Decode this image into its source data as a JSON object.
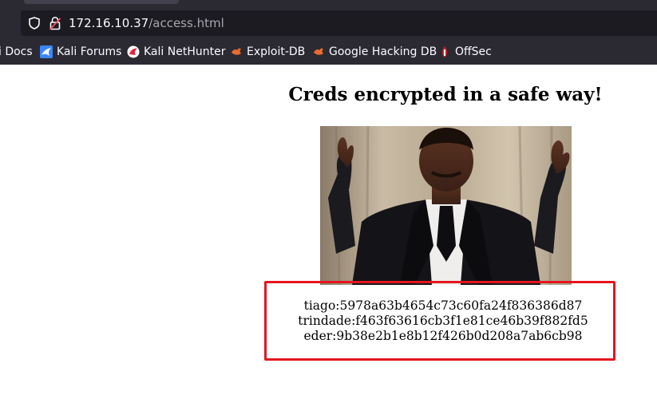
{
  "browser": {
    "url_host": "172.16.10.37",
    "url_path": "/access.html",
    "icons": {
      "tracking": "shield-icon",
      "security": "insecure-lock-icon"
    }
  },
  "bookmarks": [
    {
      "label": "i Docs",
      "icon": "none"
    },
    {
      "label": "Kali Forums",
      "icon": "kali-dragon-icon"
    },
    {
      "label": "Kali NetHunter",
      "icon": "kali-nethunter-icon"
    },
    {
      "label": "Exploit-DB",
      "icon": "exploit-db-icon"
    },
    {
      "label": "Google Hacking DB",
      "icon": "exploit-db-icon"
    },
    {
      "label": "OffSec",
      "icon": "offsec-icon"
    }
  ],
  "page": {
    "heading": "Creds encrypted in a safe way!",
    "image": "photo of a man in a tuxedo with raised arms",
    "credentials": [
      "tiago:5978a63b4654c73c60fa24f836386d87",
      "trindade:f463f63616cb3f1e81ce46b39f882fd5",
      "eder:9b38e2b1e8b12f426b0d208a7ab6cb98"
    ],
    "highlight_color": "#e3161f"
  }
}
